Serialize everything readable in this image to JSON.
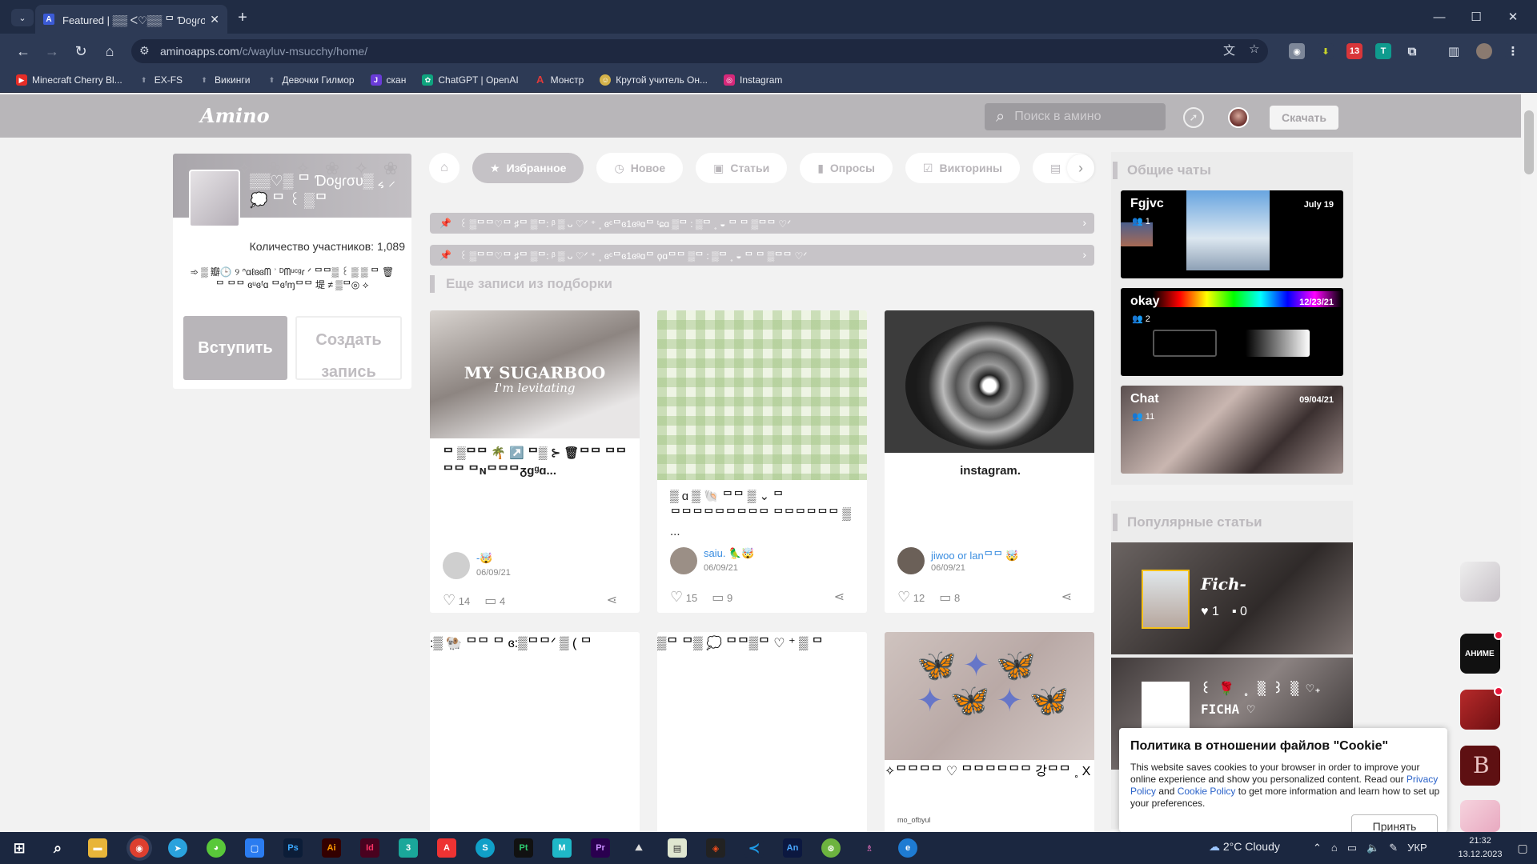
{
  "browser": {
    "tab_title": "Featured | ▒▒ ᐸ♡▒▒ ᄆ Ɗоყɾσυ",
    "tab_favicon": "A",
    "url_host": "aminoapps.com",
    "url_path": "/c/wayluv-msucchy/home/",
    "bookmarks": [
      {
        "label": "Minecraft Cherry Bl...",
        "icon": "youtube-icon",
        "color": "#e52d27"
      },
      {
        "label": "EX-FS",
        "icon": "pin-icon",
        "color": "#555"
      },
      {
        "label": "Викинги",
        "icon": "pin-icon",
        "color": "#555"
      },
      {
        "label": "Девочки Гилмор",
        "icon": "pin-icon",
        "color": "#555"
      },
      {
        "label": "скан",
        "icon": "jpg-icon",
        "color": "#6a3cd8"
      },
      {
        "label": "ChatGPT | OpenAI",
        "icon": "openai-icon",
        "color": "#0fa47f"
      },
      {
        "label": "Монстр",
        "icon": "a-icon",
        "color": "#e03a3a"
      },
      {
        "label": "Крутой учитель Он...",
        "icon": "face-icon",
        "color": "#d4b24a"
      },
      {
        "label": "Instagram",
        "icon": "instagram-icon",
        "color": "#d6287a"
      }
    ]
  },
  "header": {
    "logo": "Amino",
    "search_placeholder": "Поиск в амино",
    "download": "Скачать"
  },
  "community": {
    "name": "▒▒♡▒ ᄆ Ɗоყɾσυ▒ ៹ ⸝ 💭 ᄆ ꒰ ▒ᄆ",
    "members": "Количество участников: 1,089",
    "tagline": "➾ ▒ 瓣🕒 ୨ ᐢɑℓɞɞᗰ ʾ ᴰᗰᵘᶜᵍɾ ᐟ ᄆᄆ▒ ꒰ ▒ ▒ ᄆ 🗑ᄆ ᄆᄆ ɞᵘɞᶠɑ ᄆɞᶠɱᄆᄆ 堤 ≠ ▒ᄆ◎ ⟡",
    "join": "Вступить",
    "create_post": "Создать запись"
  },
  "tabs": [
    {
      "label": "Избранное",
      "icon": "star-icon",
      "active": true
    },
    {
      "label": "Новое",
      "icon": "clock-icon",
      "active": false
    },
    {
      "label": "Статьи",
      "icon": "article-icon",
      "active": false
    },
    {
      "label": "Опросы",
      "icon": "poll-icon",
      "active": false
    },
    {
      "label": "Викторины",
      "icon": "quiz-icon",
      "active": false
    },
    {
      "label": "О",
      "icon": "chat-icon",
      "active": false
    }
  ],
  "pinned": [
    "꒰ ▒ᄆᄆ♡ᄆ ♯ᄆ ▒ᄆ: ᵝ ▒ ᴗ ♡ᐟ ⁺ ˳ ɞᶜᄆɞ1ɞᵍɑᄆ ᵗɕɑ ▒ᄆ : ▒ᄆ ˳ ◒ ᄆ ᄆ ▒ᄆᄆ ♡ᐟ",
    "꒰ ▒ᄆᄆ♡ᄆ ♯ᄆ ▒ᄆ: ᵝ ▒ ᴗ ♡ᐟ ⁺ ˳ ɞᶜᄆɞ1ɞᵍɑᄆ ϙɑᄆᄆ ▒ᄆ : ▒ᄆ ˳ ◒ ᄆ ᄆ ▒ᄆᄆ ♡ᐟ"
  ],
  "more_header": "Еще записи из подборки",
  "posts": [
    {
      "image_text_1": "MY SUGARBOO",
      "image_text_2": "I'm levitating",
      "title": "ᄆ ▒ᄆᄆ 🌴 ↗️ ᄆ▒ ⊱ 🗑ᄆᄆ ᄆᄆ ᄆᄆ ᄆɴᄆᄆᄆᵹɡᵍɑ...",
      "author": "-🤯",
      "date": "06/09/21",
      "likes": "14",
      "comments": "4"
    },
    {
      "title": "▒ ɑ ▒ 🐚 ᄆᄆ ▒ ⌄ ᄆ ᄆᄆᄆᄆᄆᄆᄆᄆᄆ ᄆᄆᄆᄆᄆᄆ ▒ ...",
      "author": "saiu. 🦜🤯",
      "date": "06/09/21",
      "likes": "15",
      "comments": "9"
    },
    {
      "title": "instagram.",
      "author": "jiwoo or lanᄆᄆ 🤯",
      "date": "06/09/21",
      "likes": "12",
      "comments": "8"
    }
  ],
  "posts_row2": [
    {
      "title": ":▒ 🐏 ᄆᄆ ᄆ ɞ:▒ᄆᄆᐟ ▒ ( ᄆ"
    },
    {
      "title": "▒ᄆ ᄆ▒ 💭 ᄆᄆ▒ᄆ ♡ ⁺ ▒ ᄆ"
    },
    {
      "title": "✧ᄆᄆᄆᄆ ♡ ᄆᄆᄆᄆᄆᄆ 강ᄆᄆ ˳ X",
      "author": "mo_ofbyul"
    }
  ],
  "chats_header": "Общие чаты",
  "chats": [
    {
      "name": "Fgjvc",
      "members": "1",
      "date": "July 19"
    },
    {
      "name": "okay",
      "members": "2",
      "date": "12/23/21"
    },
    {
      "name": "Chat",
      "members": "11",
      "date": "09/04/21"
    }
  ],
  "articles_header": "Популярные статьи",
  "articles": [
    {
      "title": "Fich-",
      "likes": "1",
      "comments": "0"
    },
    {
      "title": "꒰ 🌹 ˳ ▒ ꒱ ▒ ♡₊ FICHA ♡"
    }
  ],
  "cookie": {
    "title": "Политика в отношении файлов \"Cookie\"",
    "text_1": "This website saves cookies to your browser in order to improve your online experience and show you personalized content. Read our ",
    "link_1": "Privacy Policy",
    "text_2": " and ",
    "link_2": "Cookie Policy",
    "text_3": " to get more information and learn how to set up your preferences.",
    "accept": "Принять"
  },
  "taskbar": {
    "weather": "2°C  Cloudy",
    "lang": "УКР",
    "time": "21:32",
    "date": "13.12.2023"
  }
}
